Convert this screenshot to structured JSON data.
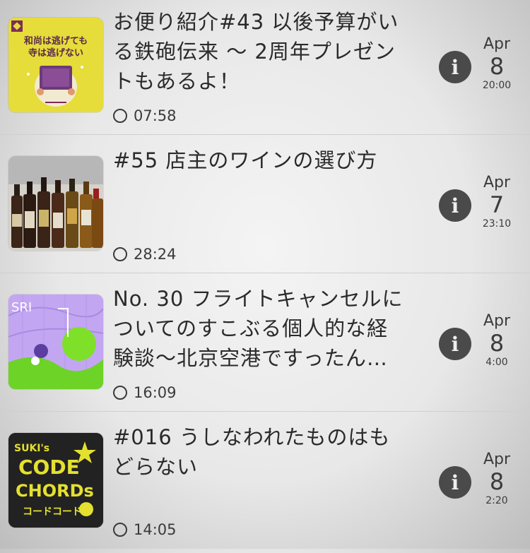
{
  "episodes": [
    {
      "title": "お便り紹介#43 以後予算がいる鉄砲伝来 〜 2周年プレゼントもあるよ！",
      "title_lines": [
        "お便り紹介#43 以後予算がい",
        "る鉄砲伝来 〜 2周年プレゼン",
        "トもあるよ！"
      ],
      "duration": "07:58",
      "month": "Apr",
      "day": "8",
      "time": "20:00",
      "art_text": [
        "和尚は逃げても",
        "寺は逃げない"
      ],
      "art_colors": {
        "bg": "#e6dc3a",
        "accent": "#6d3a7a"
      }
    },
    {
      "title": "#55 店主のワインの選び方",
      "title_lines": [
        "#55 店主のワインの選び方"
      ],
      "duration": "28:24",
      "month": "Apr",
      "day": "7",
      "time": "23:10",
      "art_colors": {
        "bg": "#dcdcdc"
      }
    },
    {
      "title": "No. 30 フライトキャンセルについてのすこぶる個人的な経験談〜北京空港ですったん…",
      "title_lines": [
        "No. 30 フライトキャンセルに",
        "ついてのすこぶる個人的な経",
        "験談〜北京空港ですったん…"
      ],
      "duration": "16:09",
      "month": "Apr",
      "day": "8",
      "time": "4:00",
      "art_text": [
        "SRI"
      ],
      "art_colors": {
        "bg": "#c3a6f2",
        "accent": "#7fe02a"
      }
    },
    {
      "title": "#016 うしなわれたものはもどらない",
      "title_lines": [
        "#016 うしなわれたものはも",
        "どらない"
      ],
      "duration": "14:05",
      "month": "Apr",
      "day": "8",
      "time": "2:20",
      "art_text": [
        "SUKI's",
        "CODE",
        "CHORDs",
        "コードコード"
      ],
      "art_colors": {
        "bg": "#222222",
        "accent": "#e4e030"
      }
    }
  ],
  "info_icon": "info-icon",
  "duration_icon": "clock-icon"
}
